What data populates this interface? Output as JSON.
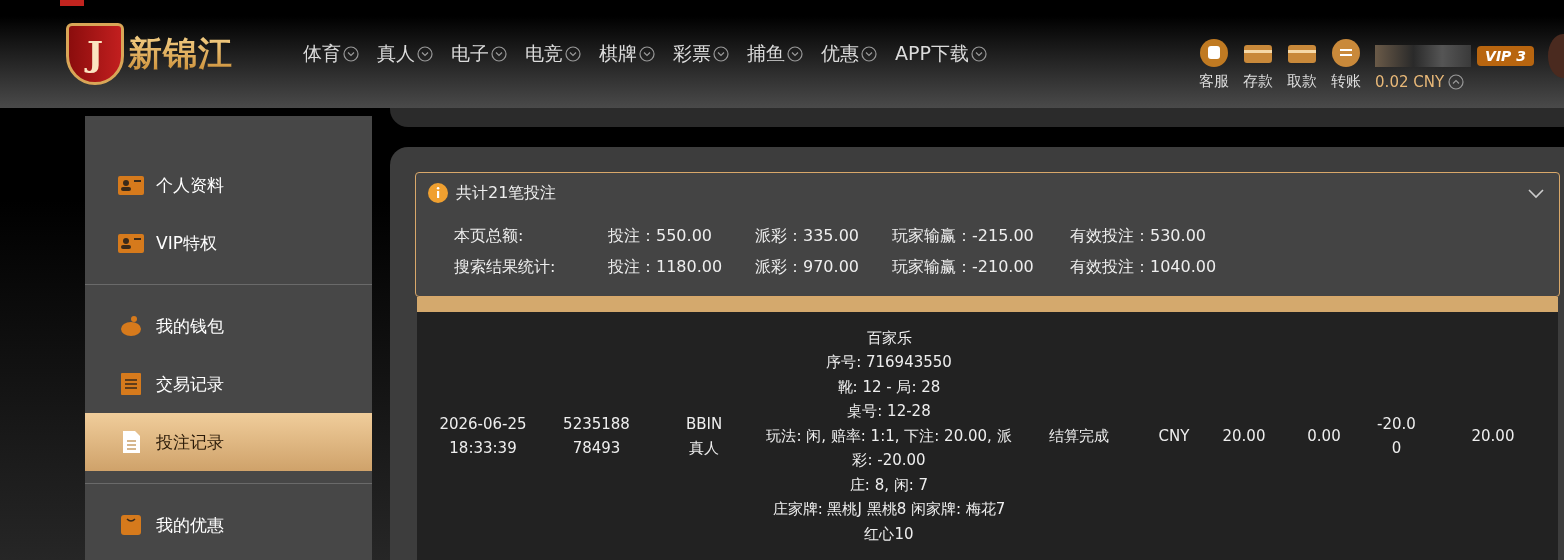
{
  "logo": {
    "mark": "J",
    "name": "新锦江"
  },
  "nav": [
    "体育",
    "真人",
    "电子",
    "电竞",
    "棋牌",
    "彩票",
    "捕鱼",
    "优惠",
    "APP下载"
  ],
  "actions": [
    "客服",
    "存款",
    "取款",
    "转账"
  ],
  "account": {
    "vip": "VIP 3",
    "balance": "0.02 CNY"
  },
  "sidebar": {
    "groups": [
      [
        {
          "label": "个人资料",
          "selected": false
        },
        {
          "label": "VIP特权",
          "selected": false
        }
      ],
      [
        {
          "label": "我的钱包",
          "selected": false
        },
        {
          "label": "交易记录",
          "selected": false
        },
        {
          "label": "投注记录",
          "selected": true
        }
      ],
      [
        {
          "label": "我的优惠",
          "selected": false
        }
      ]
    ]
  },
  "summary": {
    "title": "共计21笔投注",
    "expanded": true,
    "rows": [
      {
        "label": "本页总额:",
        "stats": [
          "投注：550.00",
          "派彩：335.00",
          "玩家输赢：-215.00",
          "有效投注：530.00"
        ]
      },
      {
        "label": "搜索结果统计:",
        "stats": [
          "投注：1180.00",
          "派彩：970.00",
          "玩家输赢：-210.00",
          "有效投注：1040.00"
        ]
      }
    ]
  },
  "table": {
    "rows": [
      {
        "time": "2026-06-25 18:33:39",
        "order": "523518878493",
        "platform": "BBIN 真人",
        "detail": [
          "百家乐",
          "序号: 716943550",
          "靴: 12 - 局: 28",
          "桌号: 12-28",
          "玩法: 闲, 赔率: 1:1, 下注: 20.00, 派彩: -20.00",
          "庄: 8, 闲: 7",
          "庄家牌: 黑桃J 黑桃8 闲家牌: 梅花7 红心10"
        ],
        "status": "结算完成",
        "currency": "CNY",
        "bet": "20.00",
        "payout": "0.00",
        "win_loss": "-20.00",
        "valid_bet": "20.00"
      }
    ]
  }
}
